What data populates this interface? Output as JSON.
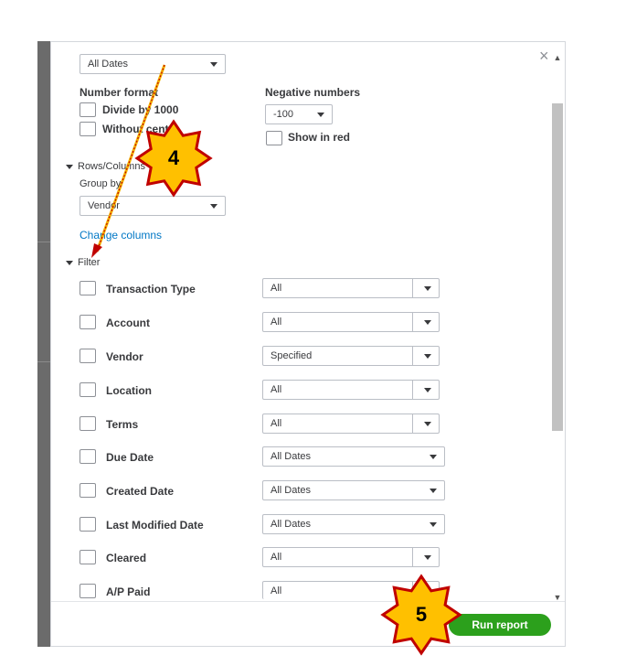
{
  "top_select": {
    "value": "All Dates"
  },
  "number_format": {
    "heading": "Number format",
    "divide_label": "Divide by 1000",
    "without_label": "Without cents"
  },
  "negative_numbers": {
    "heading": "Negative numbers",
    "value": "-100",
    "show_red_label": "Show in red"
  },
  "rows_columns": {
    "heading": "Rows/Columns",
    "group_by_label": "Group by",
    "group_by_value": "Vendor",
    "change_columns": "Change columns"
  },
  "filter": {
    "heading": "Filter",
    "rows": [
      {
        "label": "Transaction Type",
        "value": "All"
      },
      {
        "label": "Account",
        "value": "All"
      },
      {
        "label": "Vendor",
        "value": "Specified"
      },
      {
        "label": "Location",
        "value": "All"
      },
      {
        "label": "Terms",
        "value": "All"
      },
      {
        "label": "Due Date",
        "value": "All Dates"
      },
      {
        "label": "Created Date",
        "value": "All Dates"
      },
      {
        "label": "Last Modified Date",
        "value": "All Dates"
      },
      {
        "label": "Cleared",
        "value": "All"
      },
      {
        "label": "A/P Paid",
        "value": "All"
      }
    ]
  },
  "footer": {
    "run_report": "Run report"
  },
  "close_icon": "×",
  "annotations": {
    "step4": "4",
    "step5": "5"
  },
  "colors": {
    "accent_green": "#2ca01c",
    "link_blue": "#0077c5",
    "badge_fill": "#ffc000",
    "badge_stroke": "#c00000"
  }
}
